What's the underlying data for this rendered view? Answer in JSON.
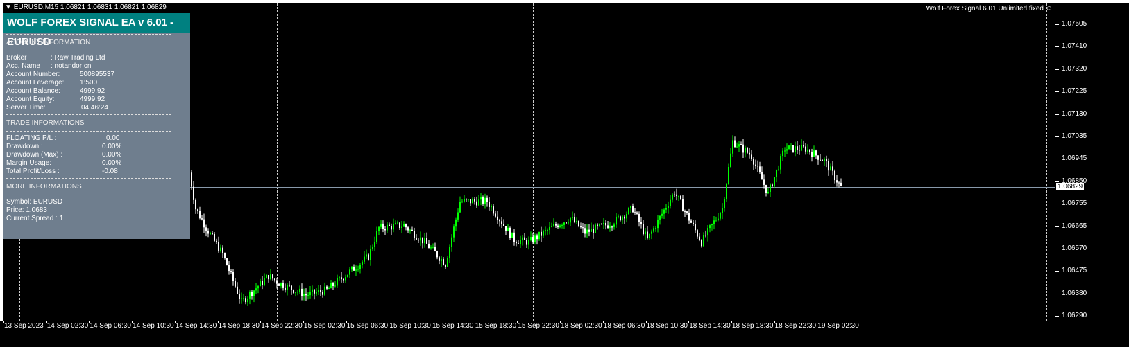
{
  "symbol_bar": "EURUSD,M15  1.06821 1.06831 1.06821 1.06829",
  "ea_label": "Wolf Forex Signal 6.01 Unlimited.fixed",
  "ea_icon": "smiley-icon",
  "current_price": "1.06829",
  "panel": {
    "title": "WOLF FOREX SIGNAL EA v 6.01 - EURUSD",
    "account_header": "ACCOUNT INFORMATION",
    "account": [
      {
        "label": "Broker",
        "value": ":  Raw Trading Ltd"
      },
      {
        "label": "Acc. Name",
        "value": ":  notandor cn"
      },
      {
        "label": "Account Number:",
        "value": "500895537"
      },
      {
        "label": "Account Leverage:",
        "value": "1:500"
      },
      {
        "label": "Account Balance:",
        "value": "4999.92"
      },
      {
        "label": "Account Equity:",
        "value": "4999.92"
      },
      {
        "label": "Server Time:",
        "value": "04:46:24"
      }
    ],
    "trade_header": "TRADE INFORMATIONS",
    "trade": [
      {
        "label": "FLOATING P/L :",
        "value": "0.00"
      },
      {
        "label": "Drawdown :",
        "value": "0.00%"
      },
      {
        "label": "Drawdown (Max) :",
        "value": "0.00%"
      },
      {
        "label": "Margin Usage:",
        "value": "0.00%"
      },
      {
        "label": "Total Profit/Loss :",
        "value": "-0.08"
      }
    ],
    "more_header": "MORE INFORMATIONS",
    "more": [
      "Symbol: EURUSD",
      "Price:  1.0683",
      "Current Spread  :  1"
    ]
  },
  "price_axis": [
    "1.07505",
    "1.07410",
    "1.07320",
    "1.07225",
    "1.07130",
    "1.07035",
    "1.06945",
    "1.06850",
    "1.06755",
    "1.06665",
    "1.06570",
    "1.06475",
    "1.06380",
    "1.06290"
  ],
  "time_axis": [
    "13 Sep 2023",
    "14 Sep 02:30",
    "14 Sep 06:30",
    "14 Sep 10:30",
    "14 Sep 14:30",
    "14 Sep 18:30",
    "14 Sep 22:30",
    "15 Sep 02:30",
    "15 Sep 06:30",
    "15 Sep 10:30",
    "15 Sep 14:30",
    "15 Sep 18:30",
    "15 Sep 22:30",
    "18 Sep 02:30",
    "18 Sep 06:30",
    "18 Sep 10:30",
    "18 Sep 14:30",
    "18 Sep 18:30",
    "18 Sep 22:30",
    "19 Sep 02:30"
  ],
  "chart_data": {
    "type": "candlestick",
    "symbol": "EURUSD",
    "timeframe": "M15",
    "ylim": [
      1.0629,
      1.07505
    ],
    "bull_color": "#00ff00",
    "bear_color": "#ffffff",
    "close_path": [
      [
        0,
        1.0694
      ],
      [
        4,
        1.0674
      ],
      [
        11,
        1.0663
      ],
      [
        17,
        1.0655
      ],
      [
        26,
        1.0635
      ],
      [
        39,
        1.0646
      ],
      [
        44,
        1.0643
      ],
      [
        57,
        1.0638
      ],
      [
        67,
        1.064
      ],
      [
        77,
        1.0647
      ],
      [
        87,
        1.0654
      ],
      [
        92,
        1.0666
      ],
      [
        104,
        1.0667
      ],
      [
        114,
        1.066
      ],
      [
        124,
        1.0651
      ],
      [
        131,
        1.0677
      ],
      [
        144,
        1.0677
      ],
      [
        157,
        1.0661
      ],
      [
        164,
        1.066
      ],
      [
        177,
        1.0667
      ],
      [
        184,
        1.067
      ],
      [
        191,
        1.0664
      ],
      [
        204,
        1.0668
      ],
      [
        214,
        1.0674
      ],
      [
        221,
        1.0661
      ],
      [
        234,
        1.0681
      ],
      [
        247,
        1.066
      ],
      [
        257,
        1.0674
      ],
      [
        262,
        1.0702
      ],
      [
        271,
        1.0696
      ],
      [
        279,
        1.068
      ],
      [
        287,
        1.0699
      ],
      [
        297,
        1.0699
      ],
      [
        306,
        1.0694
      ],
      [
        314,
        1.06829
      ]
    ]
  }
}
